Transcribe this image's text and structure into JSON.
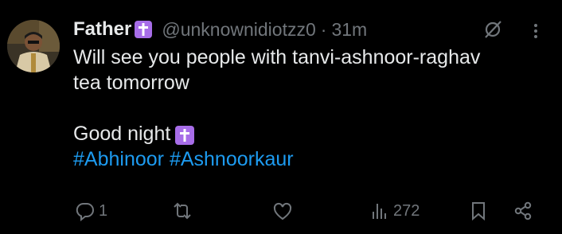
{
  "tweet": {
    "author_name": "Father",
    "handle": "@unknownidiotzz0",
    "separator": "·",
    "time": "31m",
    "lines": [
      "Will see you people with tanvi-ashnoor-raghav",
      "tea tomorrow",
      "",
      "Good night"
    ],
    "hashtags": [
      "#Abhinoor",
      "#Ashnoorkaur"
    ]
  },
  "actions": {
    "reply_count": "1",
    "retweet_count": "",
    "like_count": "",
    "views_count": "272"
  },
  "colors": {
    "background": "#000000",
    "text": "#e7e9ea",
    "muted": "#71767b",
    "link": "#1d9bf0",
    "badge": "#a76de8"
  },
  "icons": [
    "latin-cross-icon",
    "grok-icon",
    "more-icon",
    "reply-icon",
    "retweet-icon",
    "like-icon",
    "views-icon",
    "bookmark-icon",
    "share-icon"
  ]
}
